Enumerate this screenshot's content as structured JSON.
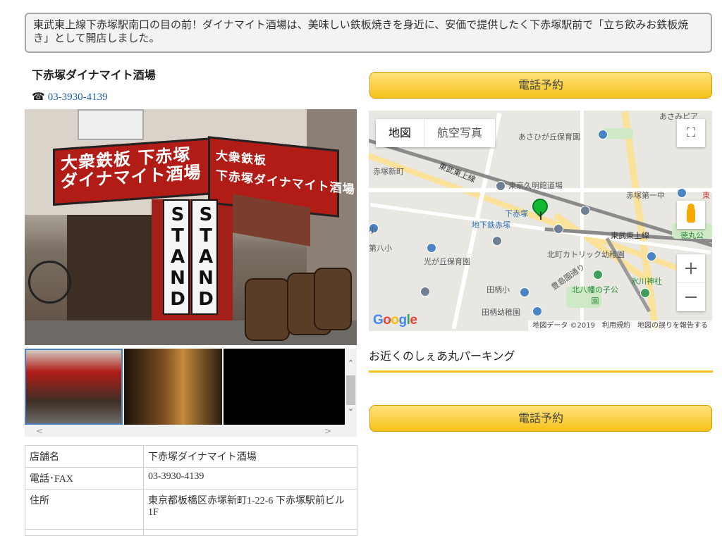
{
  "intro_text": "東武東上線下赤塚駅南口の目の前！ダイナマイト酒場は、美味しい鉄板焼きを身近に、安価で提供したく下赤塚駅前で「立ち飲みお鉄板焼き」として開店しました。",
  "shop": {
    "name": "下赤塚ダイナマイト酒場",
    "phone_icon": "☎",
    "phone": "03-3930-4139"
  },
  "photo": {
    "sign_left": "大衆鉄板 下赤塚\nダイナマイト酒場",
    "sign_right": "大衆鉄板\n下赤塚ダイナマイト酒場",
    "stand": "STAND"
  },
  "gallery": {
    "scroll_up": "⌃",
    "scroll_down": "⌄",
    "scroll_left": "<",
    "scroll_right": ">"
  },
  "info_table": {
    "rows": [
      {
        "label": "店舗名",
        "value": "下赤塚ダイナマイト酒場"
      },
      {
        "label": "電話･FAX",
        "value": "03-3930-4139"
      },
      {
        "label": "住所",
        "value": "東京都板橋区赤塚新町1-22-6 下赤塚駅前ビル1F"
      }
    ]
  },
  "buttons": {
    "tel_reserve_top": "電話予約",
    "tel_reserve_bottom": "電話予約"
  },
  "map": {
    "tab_map": "地図",
    "tab_satellite": "航空写真",
    "fullscreen_icon": "⛶",
    "zoom_in": "+",
    "zoom_out": "−",
    "logo": "Google",
    "attribution": "地図データ ©2019　利用規約　地図の誤りを報告する",
    "labels": {
      "akasaka_shinmachi": "赤塚新町",
      "tobu_tojo_line_1": "東武東上線",
      "tobu_tojo_line_2": "東武東上線",
      "kuhmeikan": "東京久明館道場",
      "akasaka_daiichi": "赤塚第一中",
      "asahigaoka_nursery": "あさひが丘保育園",
      "shimo_akatsuka": "下赤塚",
      "chikatetsu_akatsuka": "地下鉄赤塚",
      "hachiman_sho": "第八小",
      "kitamachi_catholic": "北町カトリック幼稚園",
      "hikarigaoka_nursery": "光が丘保育園",
      "tokumaru": "徳丸公",
      "tagara_sho": "田柄小",
      "kitahachiman_park": "北八幡の子公園",
      "hikawa_shrine": "氷川神社",
      "tagara_kindergarten": "田柄幼稚園",
      "toshimaen_dori": "豊島園通り",
      "asami": "あさみピア",
      "higashi": "東",
      "sho": "小"
    }
  },
  "parking": {
    "title": "お近くのしぇあ丸パーキング"
  }
}
